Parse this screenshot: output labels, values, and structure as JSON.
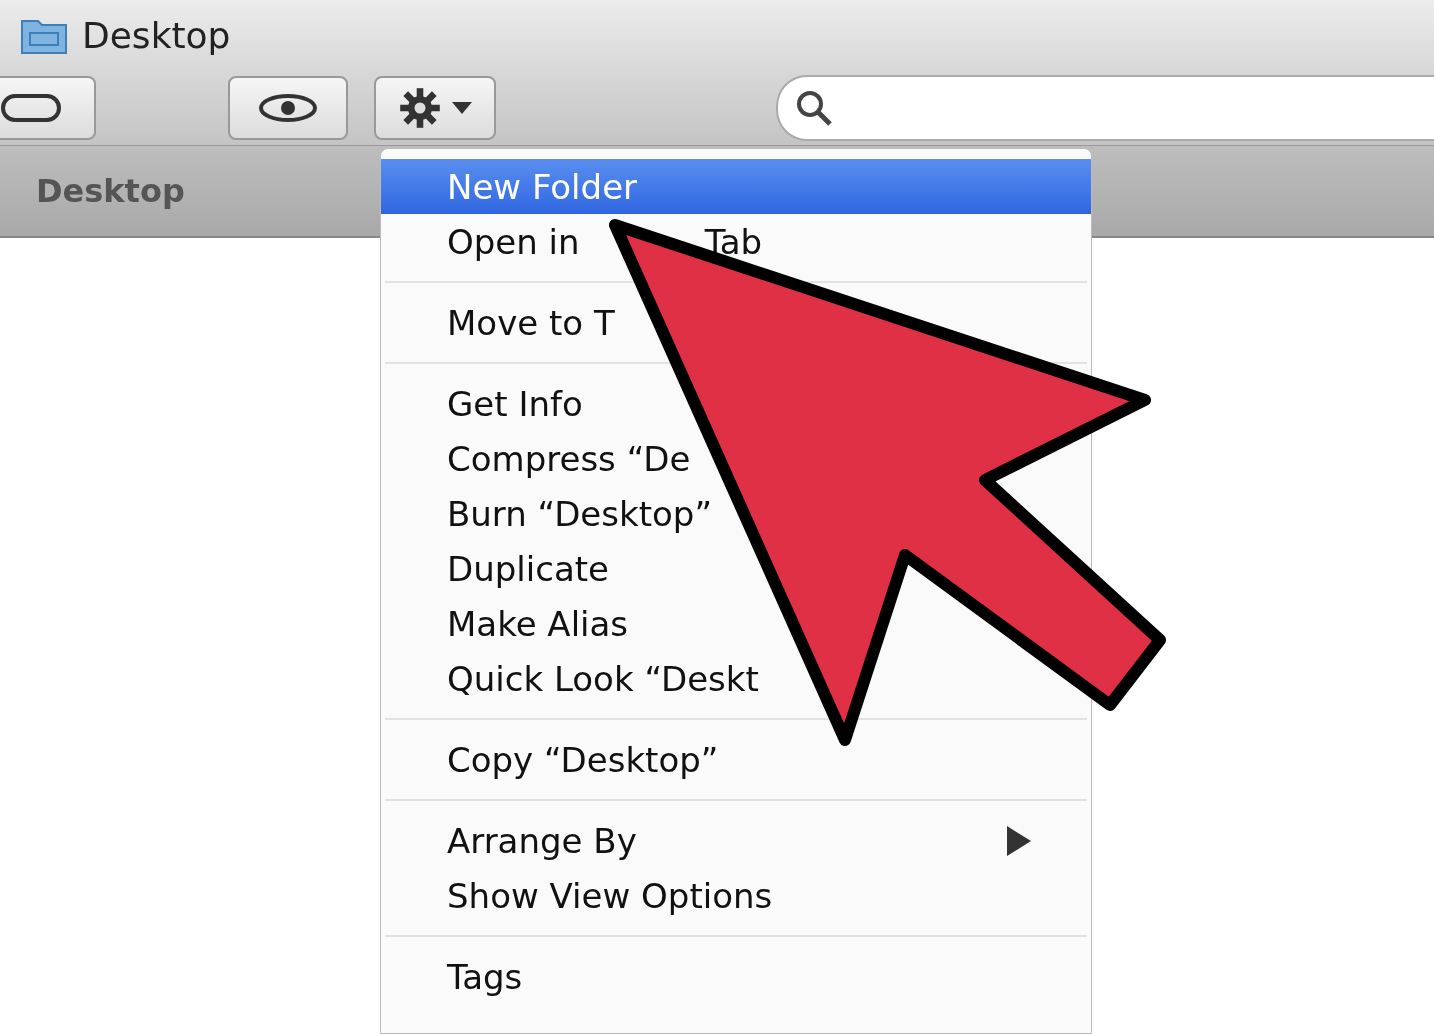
{
  "window": {
    "title": "Desktop"
  },
  "path_bar": {
    "label": "Desktop"
  },
  "menu": {
    "sections": [
      [
        {
          "label": "New Folder",
          "selected": true
        },
        {
          "label": "Open in",
          "trailing": "Tab",
          "selected": false
        }
      ],
      [
        {
          "label": "Move to T",
          "selected": false
        }
      ],
      [
        {
          "label": "Get Info",
          "selected": false
        },
        {
          "label": "Compress “De",
          "selected": false
        },
        {
          "label": "Burn “Desktop”",
          "selected": false
        },
        {
          "label": "Duplicate",
          "selected": false
        },
        {
          "label": "Make Alias",
          "selected": false
        },
        {
          "label": "Quick Look “Deskt",
          "selected": false
        }
      ],
      [
        {
          "label": "Copy “Desktop”",
          "selected": false
        }
      ],
      [
        {
          "label": "Arrange By",
          "submenu": true,
          "selected": false
        },
        {
          "label": "Show View Options",
          "selected": false
        }
      ],
      [
        {
          "label": "Tags",
          "selected": false
        }
      ]
    ]
  }
}
